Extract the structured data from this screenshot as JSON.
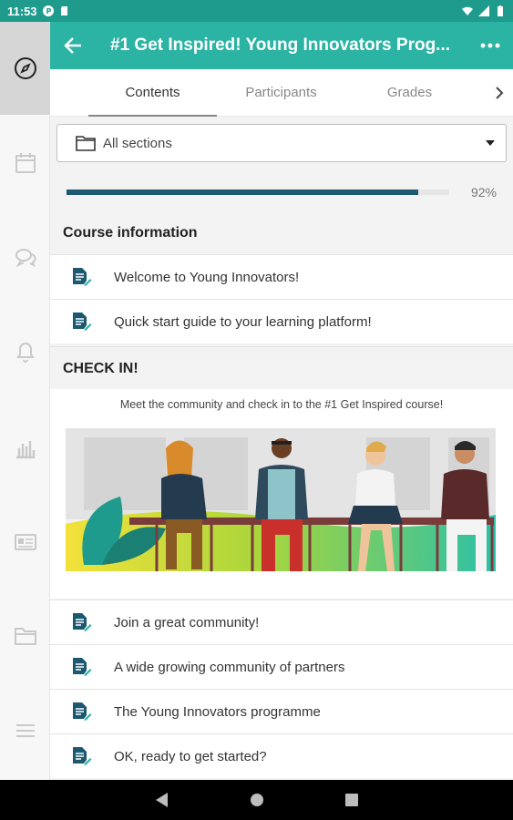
{
  "status_bar": {
    "time": "11:53"
  },
  "app_bar": {
    "title": "#1 Get Inspired! Young Innovators Prog..."
  },
  "tabs": [
    {
      "label": "Contents"
    },
    {
      "label": "Participants"
    },
    {
      "label": "Grades"
    }
  ],
  "section_select": {
    "value": "All sections"
  },
  "progress": {
    "percent_label": "92%",
    "value": 0.92
  },
  "sections": [
    {
      "title": "Course information",
      "items": [
        {
          "label": "Welcome to Young Innovators!"
        },
        {
          "label": "Quick start guide to your learning platform!"
        }
      ]
    },
    {
      "title": "CHECK IN!",
      "summary": "Meet the community and check in to the #1 Get Inspired course!",
      "items": [
        {
          "label": "Join a great community!"
        },
        {
          "label": "A wide growing community of partners"
        },
        {
          "label": "The Young Innovators programme"
        },
        {
          "label": "OK, ready to get started?"
        }
      ]
    }
  ],
  "colors": {
    "accent": "#2bb3a3",
    "status_bar": "#1f9b8d",
    "progress": "#1c5870",
    "icon": "#1c5870"
  },
  "rail_icons": [
    "compass-icon",
    "calendar-icon",
    "chat-icon",
    "bell-icon",
    "chart-icon",
    "id-card-icon",
    "folder-icon",
    "menu-icon"
  ]
}
